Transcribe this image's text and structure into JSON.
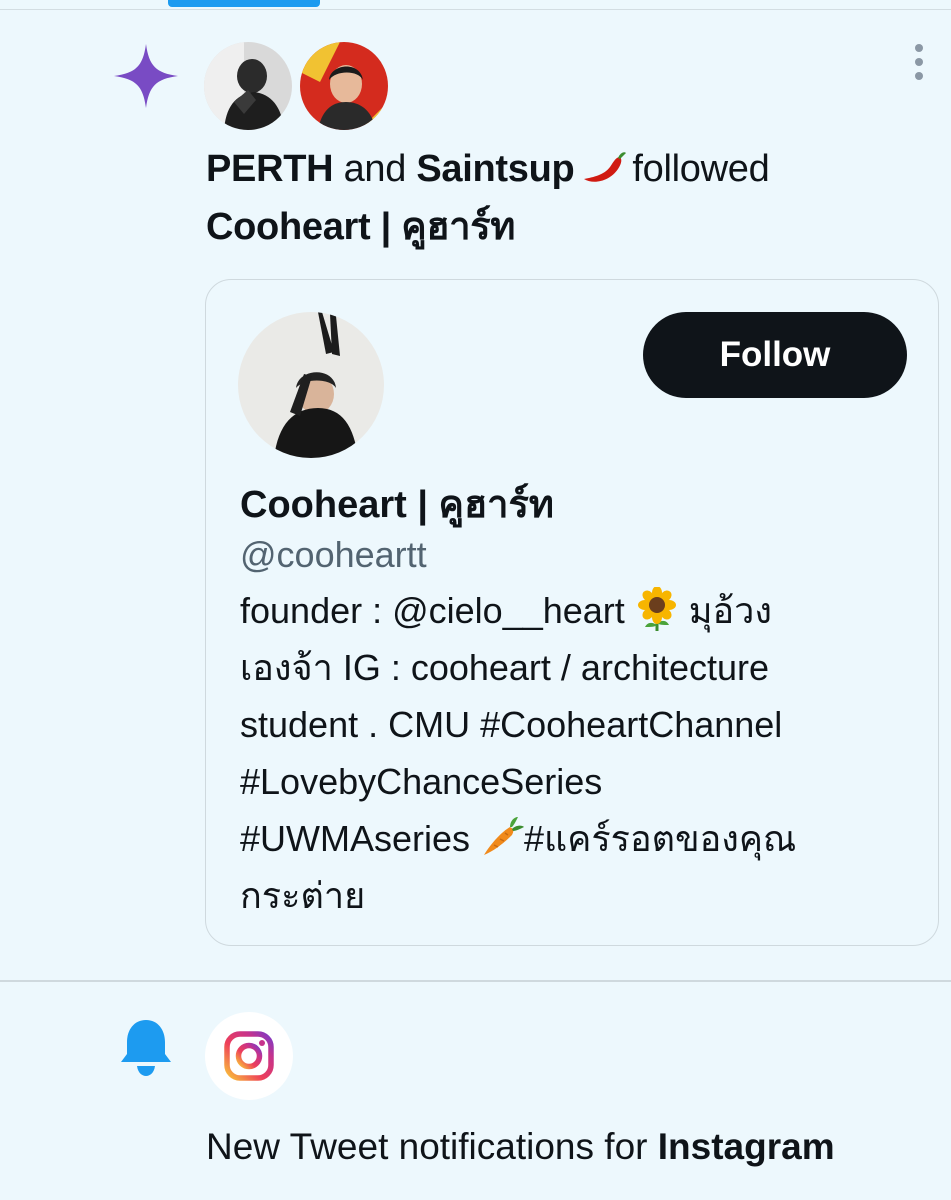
{
  "follow_notification": {
    "actor_1": "PERTH",
    "connector": "and",
    "actor_2": "Saintsup",
    "actor_2_emoji": "hot-pepper-emoji",
    "verb": "followed",
    "target": "Cooheart | คูฮาร์ท"
  },
  "profile_card": {
    "follow_label": "Follow",
    "name": "Cooheart | คูฮาร์ท",
    "handle": "@cooheartt",
    "bio": {
      "line1_a": "founder : @cielo__heart ",
      "line1_emoji": "sunflower-emoji",
      "line1_b": " มุอ้วง",
      "line2": "เองจ้า IG : cooheart / architecture",
      "line3": "student . CMU #CooheartChannel",
      "line4": "#LovebyChanceSeries",
      "line5_a": "#UWMAseries ",
      "line5_emoji": "carrot-emoji",
      "line5_b": "#แคร์รอตของคุณ",
      "line6": "กระต่าย"
    }
  },
  "tweet_notification": {
    "text": "New Tweet notifications for ",
    "account": "Instagram"
  },
  "colors": {
    "background": "#edf8fd",
    "accent_blue": "#1d9bf0",
    "spark_purple": "#794bc4",
    "text_primary": "#0f1419",
    "text_secondary": "#536471",
    "border": "#cfd9de"
  }
}
